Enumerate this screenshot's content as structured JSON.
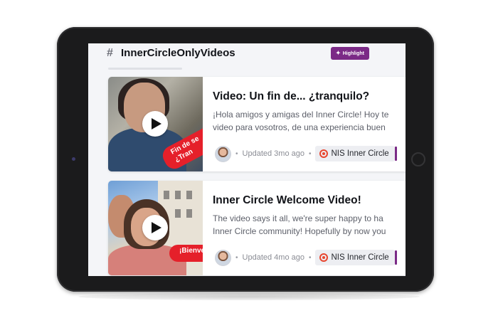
{
  "channel": {
    "title": "InnerCircleOnlyVideos",
    "highlight_label": "Highlight"
  },
  "posts": [
    {
      "title": "Video: Un fin de... ¿tranquilo?",
      "description_lines": [
        "¡Hola amigos y amigas del Inner Circle! Hoy te",
        "video para vosotros, de una experiencia buen"
      ],
      "thumbnail_text": "Fin de se\n¿Tran",
      "updated": "Updated 3mo ago",
      "tag": "NIS Inner Circle"
    },
    {
      "title": "Inner Circle Welcome Video!",
      "description_lines": [
        "The video says it all, we're super happy to ha",
        "Inner Circle community! Hopefully by now you"
      ],
      "thumbnail_text": "¡Bienve",
      "updated": "Updated 4mo ago",
      "tag": "NIS Inner Circle"
    }
  ],
  "colors": {
    "accent": "#7b2a86",
    "ribbon": "#e5202a",
    "nis_icon": "#e8462f"
  },
  "icons": {
    "channel": "hash-icon",
    "highlight": "sparkle-icon",
    "play": "play-icon",
    "tag": "nis-logo-icon"
  }
}
